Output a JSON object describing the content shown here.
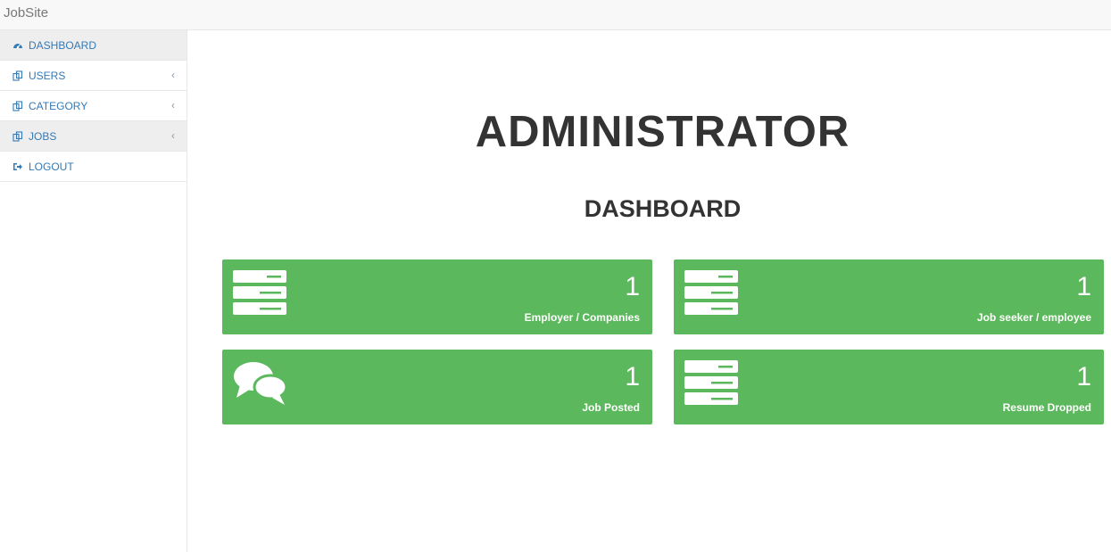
{
  "app": {
    "brand": "JobSite"
  },
  "sidebar": {
    "items": [
      {
        "label": "DASHBOARD",
        "icon": "dashboard-icon"
      },
      {
        "label": "USERS",
        "icon": "copy-icon",
        "chevron": "‹"
      },
      {
        "label": "CATEGORY",
        "icon": "copy-icon",
        "chevron": "‹"
      },
      {
        "label": "JOBS",
        "icon": "copy-icon",
        "chevron": "‹"
      },
      {
        "label": "LOGOUT",
        "icon": "logout-icon"
      }
    ]
  },
  "main": {
    "title": "ADMINISTRATOR",
    "subtitle": "DASHBOARD",
    "panels": [
      {
        "count": "1",
        "label": "Employer / Companies",
        "icon": "server-icon"
      },
      {
        "count": "1",
        "label": "Job seeker / employee",
        "icon": "server-icon"
      },
      {
        "count": "1",
        "label": "Job Posted",
        "icon": "comments-icon"
      },
      {
        "count": "1",
        "label": "Resume Dropped",
        "icon": "server-icon"
      }
    ]
  },
  "colors": {
    "panel_green": "#5cb85c",
    "link_blue": "#337ab7",
    "title_dark": "#333333"
  }
}
